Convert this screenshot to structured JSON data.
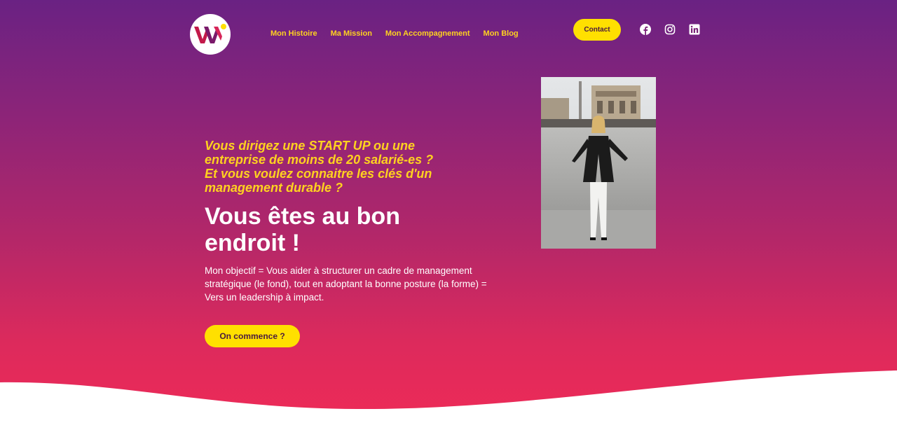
{
  "colors": {
    "accent": "#ffe000",
    "nav_text": "#ffd21f",
    "gradient_top": "#6a2283",
    "gradient_bottom": "#ef2b57"
  },
  "header": {
    "logo_icon": "ww-logo",
    "nav": [
      {
        "label": "Mon Histoire"
      },
      {
        "label": "Ma Mission"
      },
      {
        "label": "Mon Accompagnement"
      },
      {
        "label": "Mon Blog"
      }
    ],
    "contact_label": "Contact",
    "social": [
      {
        "icon": "facebook-icon"
      },
      {
        "icon": "instagram-icon"
      },
      {
        "icon": "linkedin-icon"
      }
    ]
  },
  "hero": {
    "kicker_lines": [
      "Vous dirigez une START UP ou une",
      "entreprise de moins de 20 salarié-es ?",
      "Et vous voulez connaitre les clés d'un",
      "management durable ?"
    ],
    "headline_lines": [
      "Vous êtes au bon",
      "endroit !"
    ],
    "description": "Mon objectif = Vous aider à structurer un cadre de management stratégique (le fond), tout en adoptant la bonne posture (la forme) = Vers un leadership à impact.",
    "cta_label": "On commence ?"
  }
}
